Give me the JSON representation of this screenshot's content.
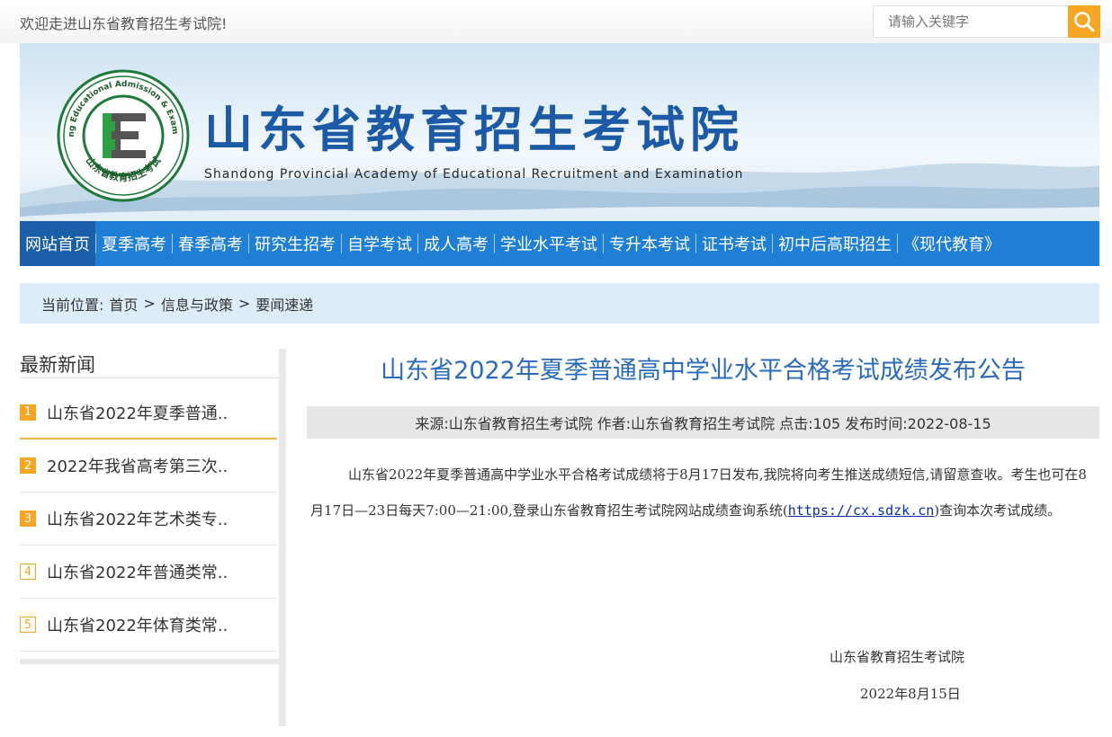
{
  "topbar": {
    "welcome": "欢迎走进山东省教育招生考试院!",
    "search_placeholder": "请输入关键字"
  },
  "banner": {
    "title": "山东省教育招生考试院",
    "subtitle": "Shandong Provincial Academy of Educational Recruitment and Examination",
    "logo_ring_text": "Shandong Educational Admission & Examinations",
    "logo_bottom_text": "山东省教育招生考试",
    "logo_letter": "E"
  },
  "nav": {
    "items": [
      {
        "label": "网站首页",
        "active": true
      },
      {
        "label": "夏季高考"
      },
      {
        "label": "春季高考"
      },
      {
        "label": "研究生招考"
      },
      {
        "label": "自学考试"
      },
      {
        "label": "成人高考"
      },
      {
        "label": "学业水平考试"
      },
      {
        "label": "专升本考试"
      },
      {
        "label": "证书考试"
      },
      {
        "label": "初中后高职招生"
      },
      {
        "label": "《现代教育》"
      }
    ]
  },
  "breadcrumb": {
    "prefix": "当前位置:",
    "items": [
      "首页",
      ">",
      "信息与政策",
      ">",
      "要闻速递"
    ]
  },
  "sidebar": {
    "title": "最新新闻",
    "items": [
      {
        "rank": "1",
        "text": "山东省2022年夏季普通.."
      },
      {
        "rank": "2",
        "text": "2022年我省高考第三次.."
      },
      {
        "rank": "3",
        "text": "山东省2022年艺术类专.."
      },
      {
        "rank": "4",
        "text": "山东省2022年普通类常.."
      },
      {
        "rank": "5",
        "text": "山东省2022年体育类常.."
      }
    ]
  },
  "article": {
    "title": "山东省2022年夏季普通高中学业水平合格考试成绩发布公告",
    "meta": "来源:山东省教育招生考试院 作者:山东省教育招生考试院 点击:105 发布时间:2022-08-15",
    "para_before_link": "山东省2022年夏季普通高中学业水平合格考试成绩将于8月17日发布,我院将向考生推送成绩短信,请留意查收。考生也可在8月17日—23日每天7:00—21:00,登录山东省教育招生考试院网站成绩查询系统(",
    "link": "https://cx.sdzk.cn",
    "para_after_link": ")查询本次考试成绩。",
    "signature": "山东省教育招生考试院",
    "date": "2022年8月15日"
  },
  "colors": {
    "nav_bg": "#1f7fd6",
    "nav_active": "#1a5fa8",
    "title_blue": "#2a6bbd",
    "accent_orange": "#f5a623",
    "crumb_bg": "#dcecf9"
  }
}
